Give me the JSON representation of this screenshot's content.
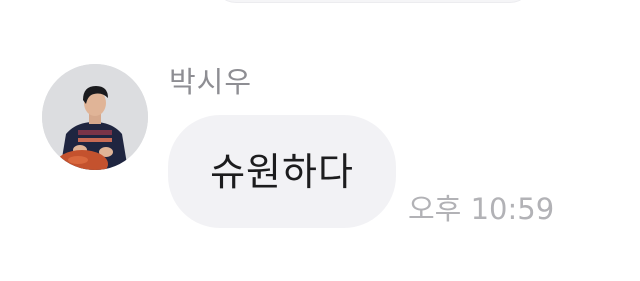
{
  "message": {
    "sender_name": "박시우",
    "text": "슈원하다",
    "timestamp": "오후 10:59",
    "avatar_icon": "profile-photo"
  },
  "colors": {
    "background": "#ffffff",
    "bubble": "#f2f2f5",
    "sender_name": "#8e8e93",
    "text": "#1c1c1e",
    "timestamp": "#b2b2b6"
  }
}
